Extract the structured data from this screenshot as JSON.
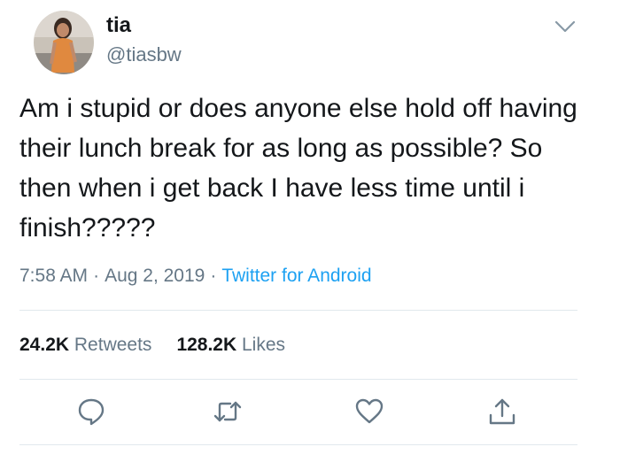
{
  "user": {
    "display_name": "tia",
    "handle": "@tiasbw"
  },
  "tweet": {
    "text": "Am i stupid or does anyone else hold off having their lunch break for as long as possible? So then when i get back I have less time until i finish?????",
    "time": "7:58 AM",
    "date": "Aug 2, 2019",
    "separator": "·",
    "source": "Twitter for Android"
  },
  "stats": {
    "retweets_count": "24.2K",
    "retweets_label": "Retweets",
    "likes_count": "128.2K",
    "likes_label": "Likes"
  },
  "icons": {
    "caret": "chevron-down-icon",
    "reply": "reply-icon",
    "retweet": "retweet-icon",
    "like": "heart-icon",
    "share": "share-icon"
  },
  "colors": {
    "text": "#14171a",
    "secondary": "#657786",
    "link": "#1da1f2",
    "divider": "#e1e8ed"
  }
}
